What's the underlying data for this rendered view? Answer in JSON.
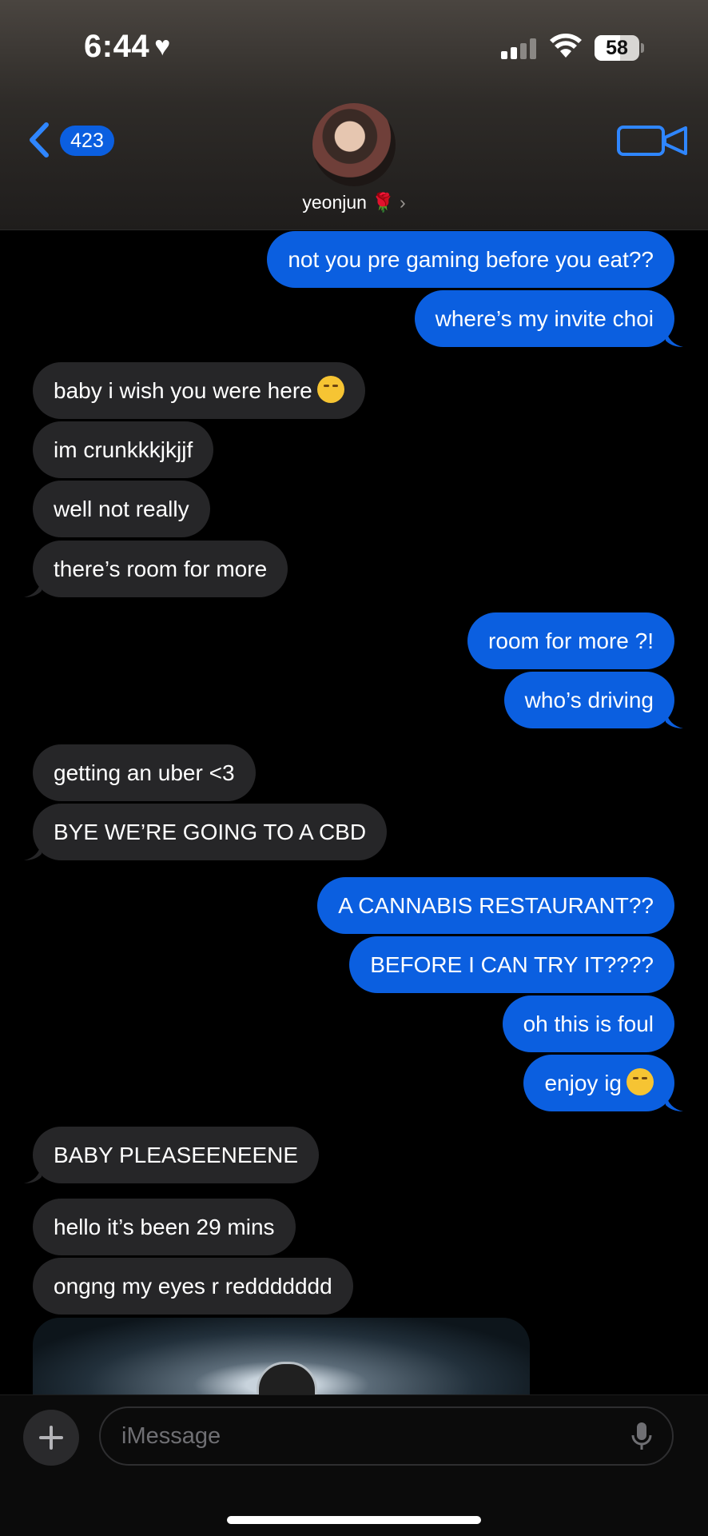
{
  "status_bar": {
    "time": "6:44",
    "heart_icon": "heart-icon",
    "battery": "58"
  },
  "nav": {
    "back_badge": "423",
    "contact_name": "yeonjun 🌹",
    "chevron": "›"
  },
  "messages": [
    {
      "dir": "out",
      "text": "not you pre gaming before you eat??"
    },
    {
      "dir": "out",
      "text": "where’s my invite choi"
    },
    {
      "dir": "in",
      "text": "baby i wish you were here",
      "emoji": "weary-face"
    },
    {
      "dir": "in",
      "text": "im crunkkkjkjjf"
    },
    {
      "dir": "in",
      "text": "well not really"
    },
    {
      "dir": "in",
      "text": "there’s room for more"
    },
    {
      "dir": "out",
      "text": "room for more ?!"
    },
    {
      "dir": "out",
      "text": "who’s driving"
    },
    {
      "dir": "in",
      "text": "getting an uber <3"
    },
    {
      "dir": "in",
      "text": "BYE WE’RE GOING TO A CBD"
    },
    {
      "dir": "out",
      "text": "A CANNABIS RESTAURANT??"
    },
    {
      "dir": "out",
      "text": "BEFORE I CAN TRY IT????"
    },
    {
      "dir": "out",
      "text": "oh this is foul"
    },
    {
      "dir": "out",
      "text": "enjoy ig",
      "emoji": "unamused-face"
    },
    {
      "dir": "in",
      "text": "BABY PLEASEENEENE"
    },
    {
      "dir": "in",
      "text": "hello it’s been 29 mins"
    },
    {
      "dir": "in",
      "text": "ongng my eyes r reddddddd"
    }
  ],
  "composer": {
    "placeholder": "iMessage"
  },
  "colors": {
    "outgoing": "#0b5fe0",
    "incoming": "#262628",
    "accent": "#2f86ff"
  }
}
